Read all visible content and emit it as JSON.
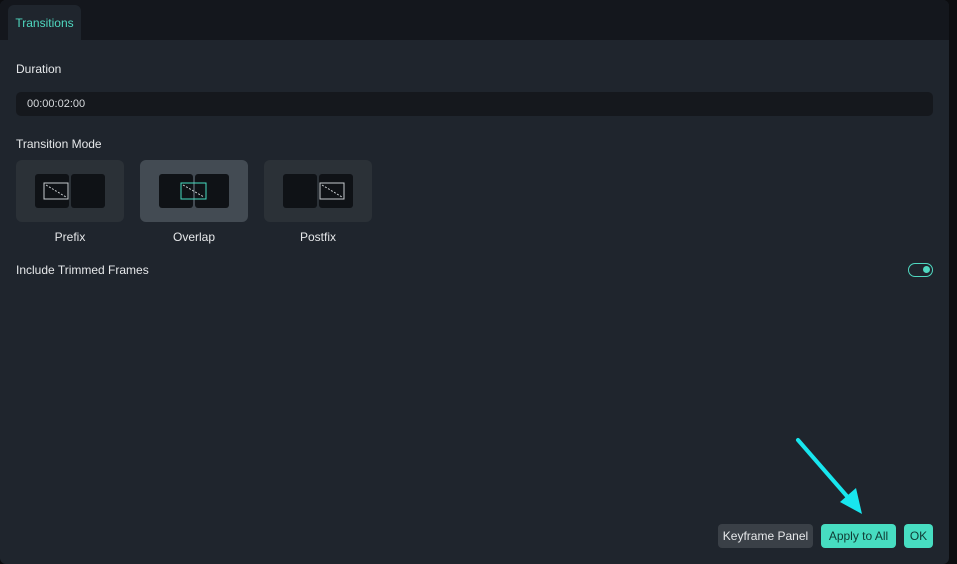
{
  "tabs": [
    {
      "label": "Transitions",
      "active": true
    }
  ],
  "duration": {
    "label": "Duration",
    "value": "00:00:02:00"
  },
  "transition_mode": {
    "label": "Transition Mode",
    "options": [
      {
        "label": "Prefix",
        "selected": false
      },
      {
        "label": "Overlap",
        "selected": true
      },
      {
        "label": "Postfix",
        "selected": false
      }
    ]
  },
  "include_trimmed_frames": {
    "label": "Include Trimmed Frames",
    "enabled": true
  },
  "footer": {
    "keyframe_panel_label": "Keyframe Panel",
    "apply_to_all_label": "Apply to All",
    "ok_label": "OK"
  },
  "colors": {
    "accent": "#47ddc1",
    "panel_bg": "#1f252d",
    "annotation_arrow": "#18e6ee"
  },
  "annotation": {
    "icon": "arrow-pointer-icon",
    "points_to": "Apply to All"
  }
}
